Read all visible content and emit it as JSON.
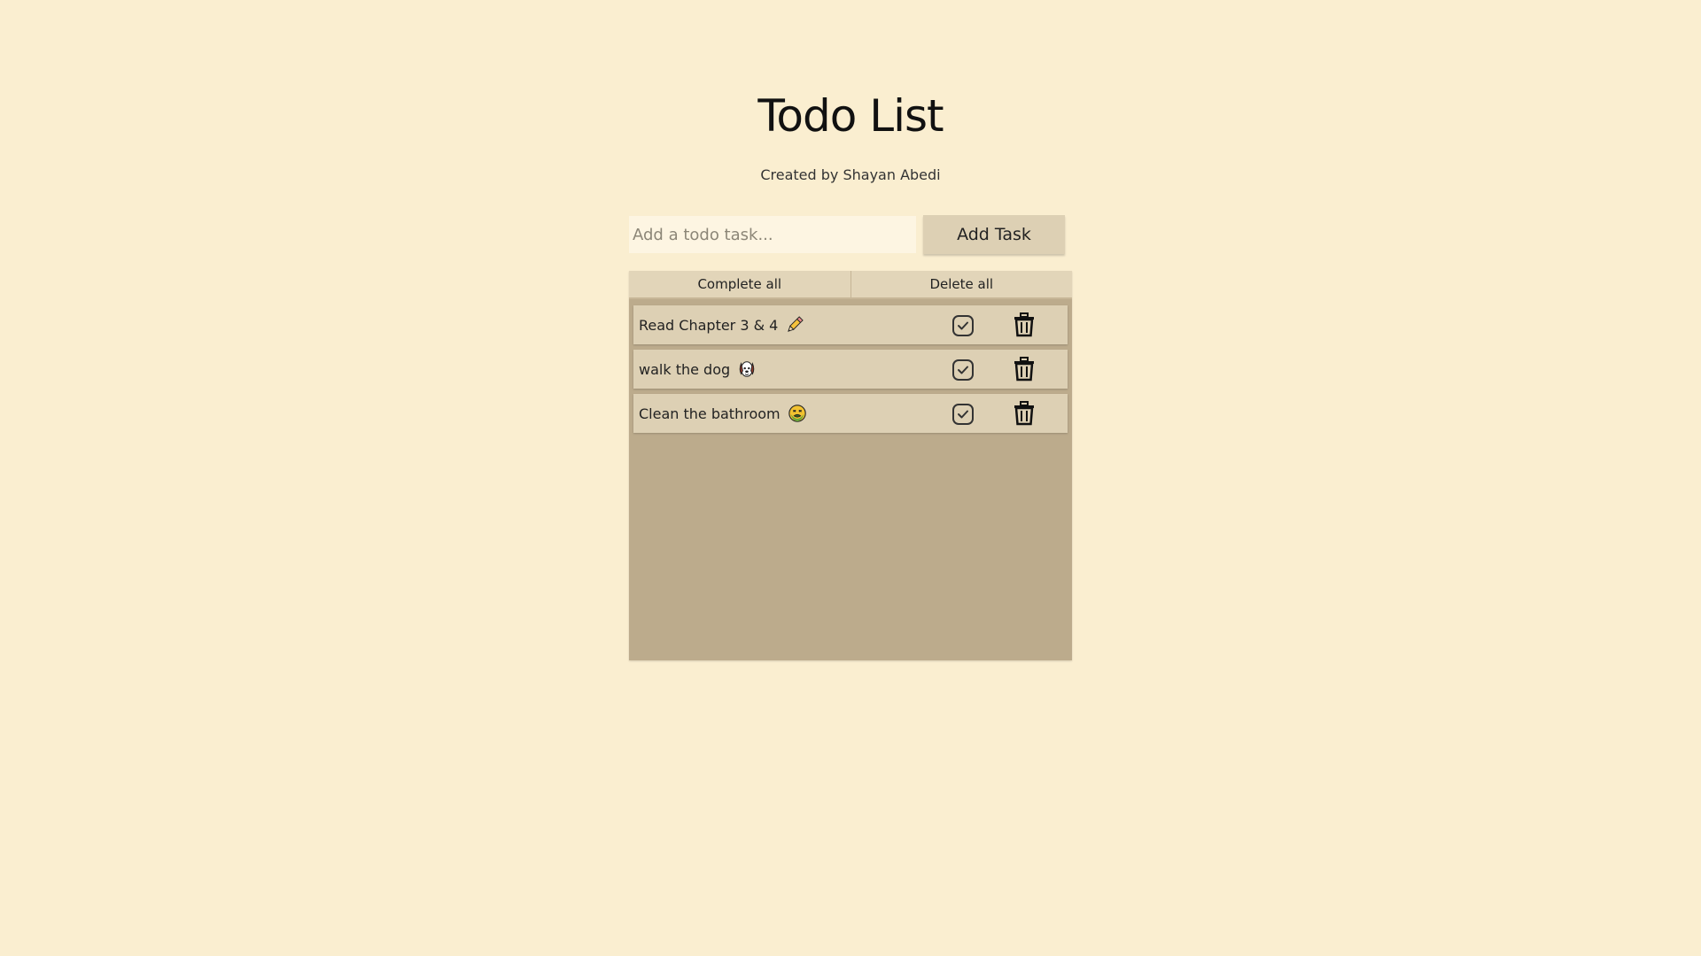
{
  "header": {
    "title": "Todo List",
    "subtitle": "Created by Shayan Abedi"
  },
  "form": {
    "input_placeholder": "Add a todo task...",
    "input_value": "",
    "add_label": "Add Task"
  },
  "bulk_actions": {
    "complete_all": "Complete all",
    "delete_all": "Delete all"
  },
  "tasks": [
    {
      "text": "Read Chapter 3 & 4",
      "icon": "pencil-icon"
    },
    {
      "text": "walk the dog",
      "icon": "dog-face-icon"
    },
    {
      "text": "Clean the bathroom",
      "icon": "nauseated-face-icon"
    }
  ],
  "colors": {
    "background": "#faeed0",
    "panel": "#bcab8c",
    "card": "#ddd0b4",
    "input": "#fdf5e2"
  }
}
